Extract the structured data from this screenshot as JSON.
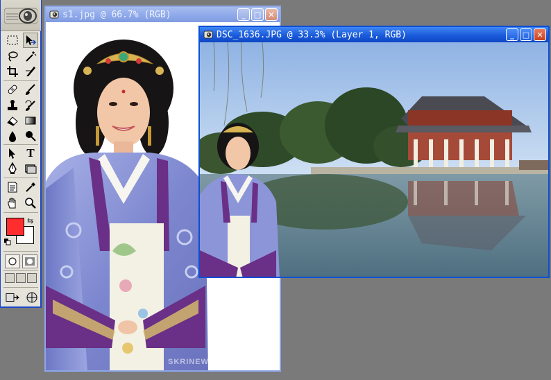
{
  "toolbox": {
    "tools": [
      {
        "name": "rectangular-marquee-icon"
      },
      {
        "name": "move-icon"
      },
      {
        "name": "lasso-icon"
      },
      {
        "name": "magic-wand-icon"
      },
      {
        "name": "crop-icon"
      },
      {
        "name": "slice-icon"
      },
      {
        "name": "healing-brush-icon"
      },
      {
        "name": "brush-icon"
      },
      {
        "name": "clone-stamp-icon"
      },
      {
        "name": "history-brush-icon"
      },
      {
        "name": "eraser-icon"
      },
      {
        "name": "gradient-icon"
      },
      {
        "name": "blur-icon"
      },
      {
        "name": "dodge-icon"
      },
      {
        "name": "path-selection-icon"
      },
      {
        "name": "type-icon"
      },
      {
        "name": "pen-icon"
      },
      {
        "name": "shape-icon"
      },
      {
        "name": "notes-icon"
      },
      {
        "name": "eyedropper-icon"
      },
      {
        "name": "hand-icon"
      },
      {
        "name": "zoom-icon"
      }
    ],
    "type_tool_glyph": "T",
    "foreground_color": "#ff2d2d",
    "background_color": "#ffffff"
  },
  "window_s1": {
    "title": "s1.jpg @ 66.7% (RGB)",
    "minimize": "_",
    "maximize": "□",
    "close": "✕",
    "watermark": "SKRINEWS"
  },
  "window_dsc": {
    "title": "DSC_1636.JPG @ 33.3% (Layer 1, RGB)",
    "minimize": "_",
    "maximize": "□",
    "close": "✕"
  },
  "colors": {
    "title_active": "#1858d8",
    "title_inactive": "#8da8ea",
    "workspace": "#7a7a7a"
  }
}
